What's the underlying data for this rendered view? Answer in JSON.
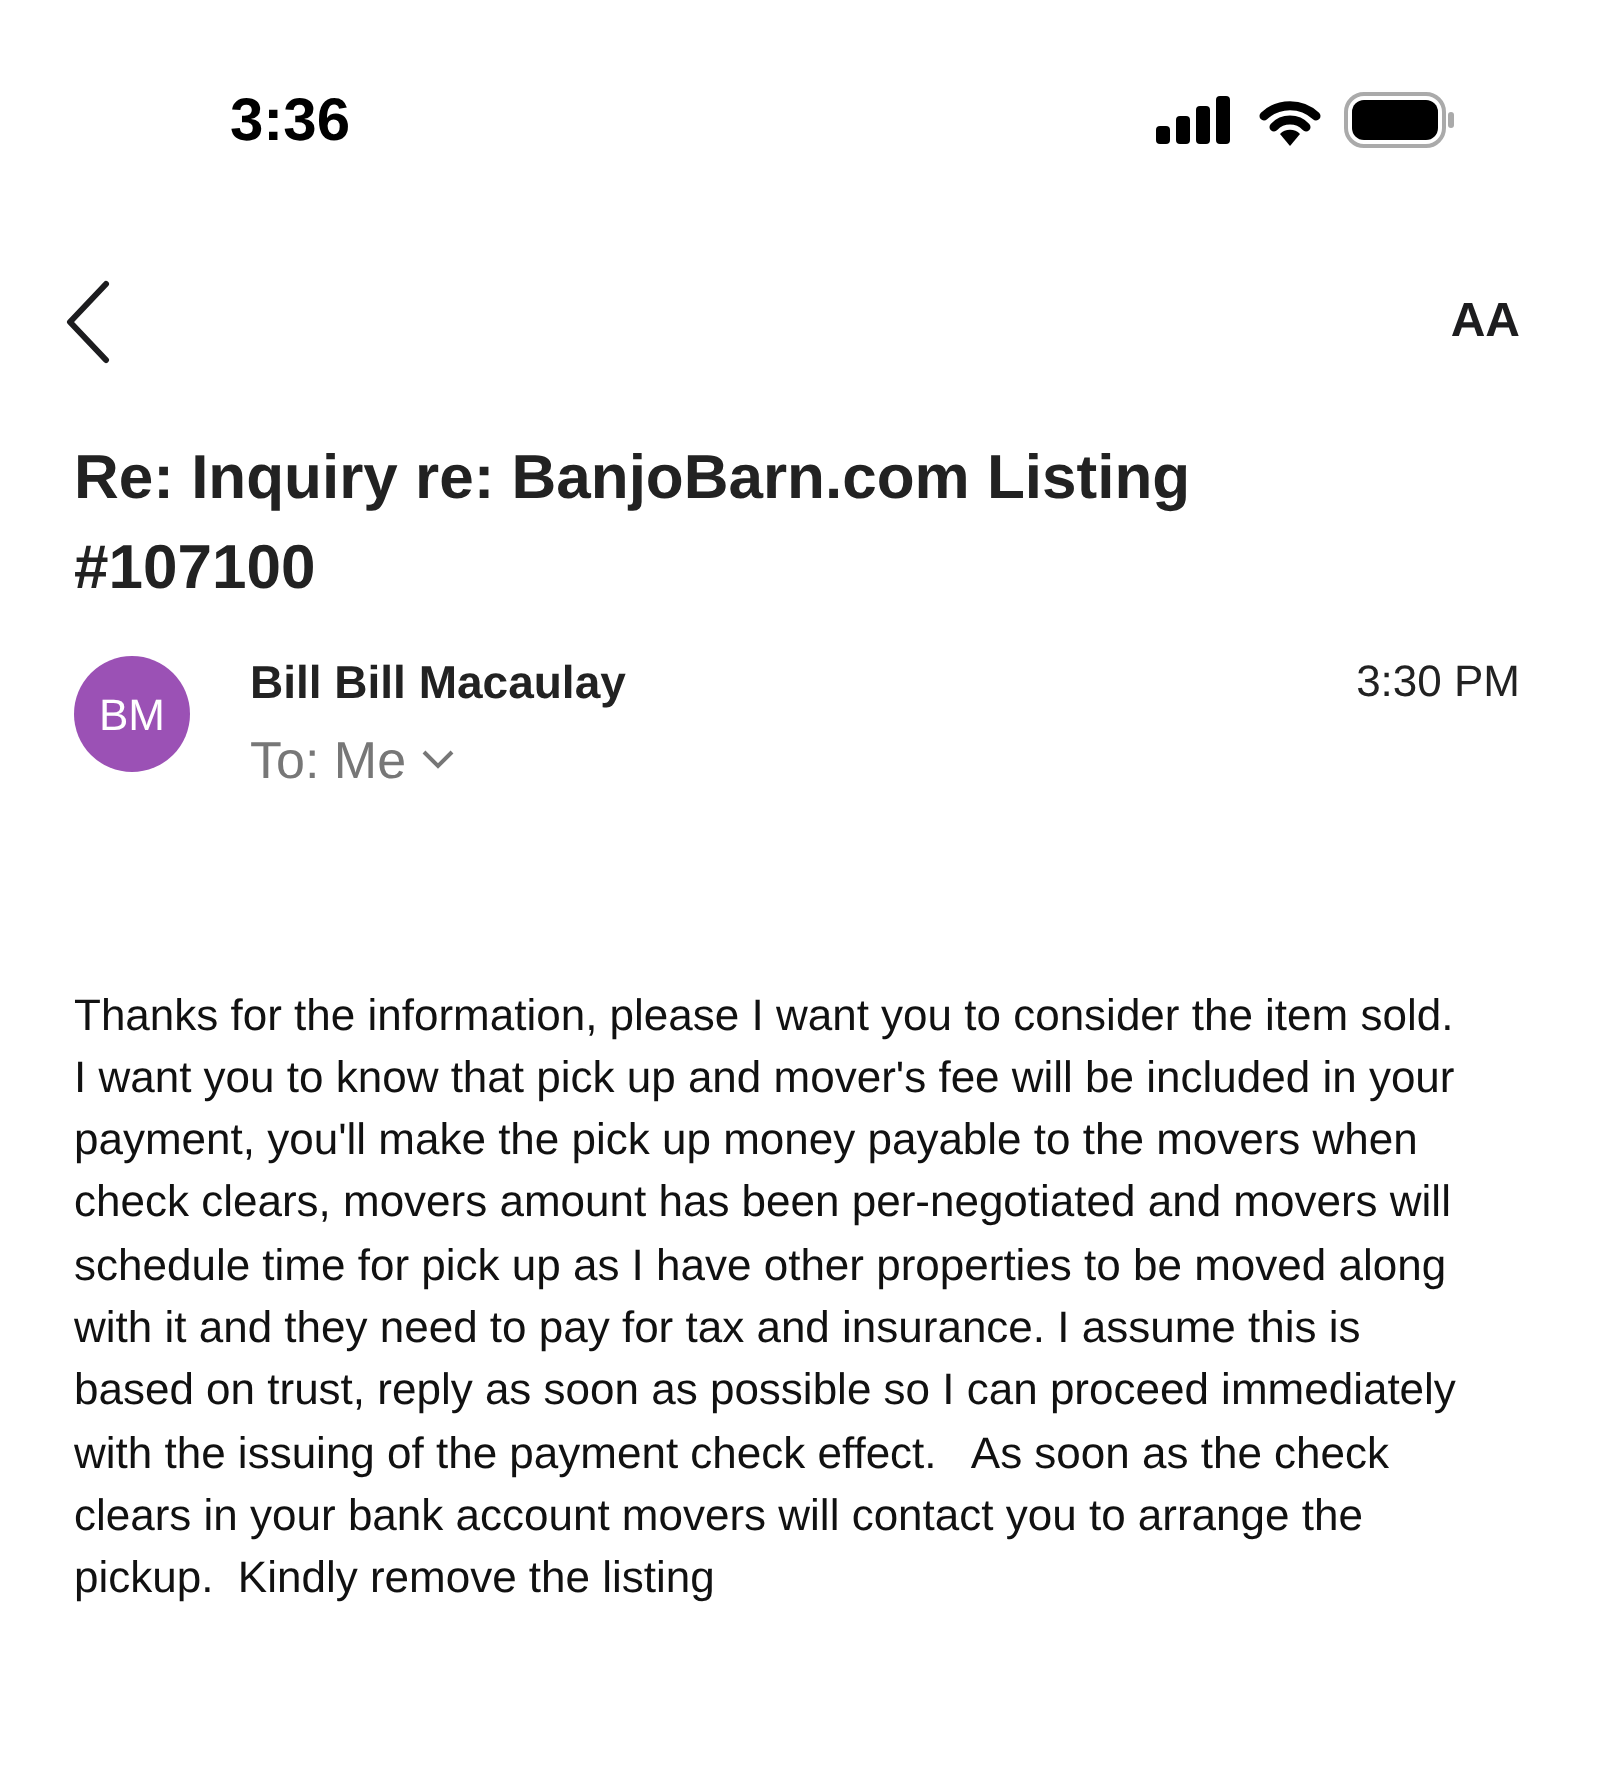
{
  "status_bar": {
    "time": "3:36"
  },
  "nav": {
    "text_size_label": "AA"
  },
  "subject": "Re: Inquiry re: BanjoBarn.com Listing #107100",
  "message": {
    "avatar_initials": "BM",
    "color": "#9b51b5",
    "sender": "Bill Bill Macaulay",
    "recipient": "To: Me",
    "time": "3:30 PM"
  },
  "body": "Thanks for the information, please I want you to consider the item sold. I want you to know that pick up and mover's fee will be included in your payment, you'll make the pick up money payable to the movers when check clears, movers amount has been per-negotiated and movers will schedule time for pick up as I have other properties to be moved along with it and they need to pay for tax and insurance. I assume this is based on trust, reply as soon as possible so I can proceed immediately with the issuing of the payment check effect.   As soon as the check clears in your bank account movers will contact you to arrange the pickup.  Kindly remove the listing"
}
